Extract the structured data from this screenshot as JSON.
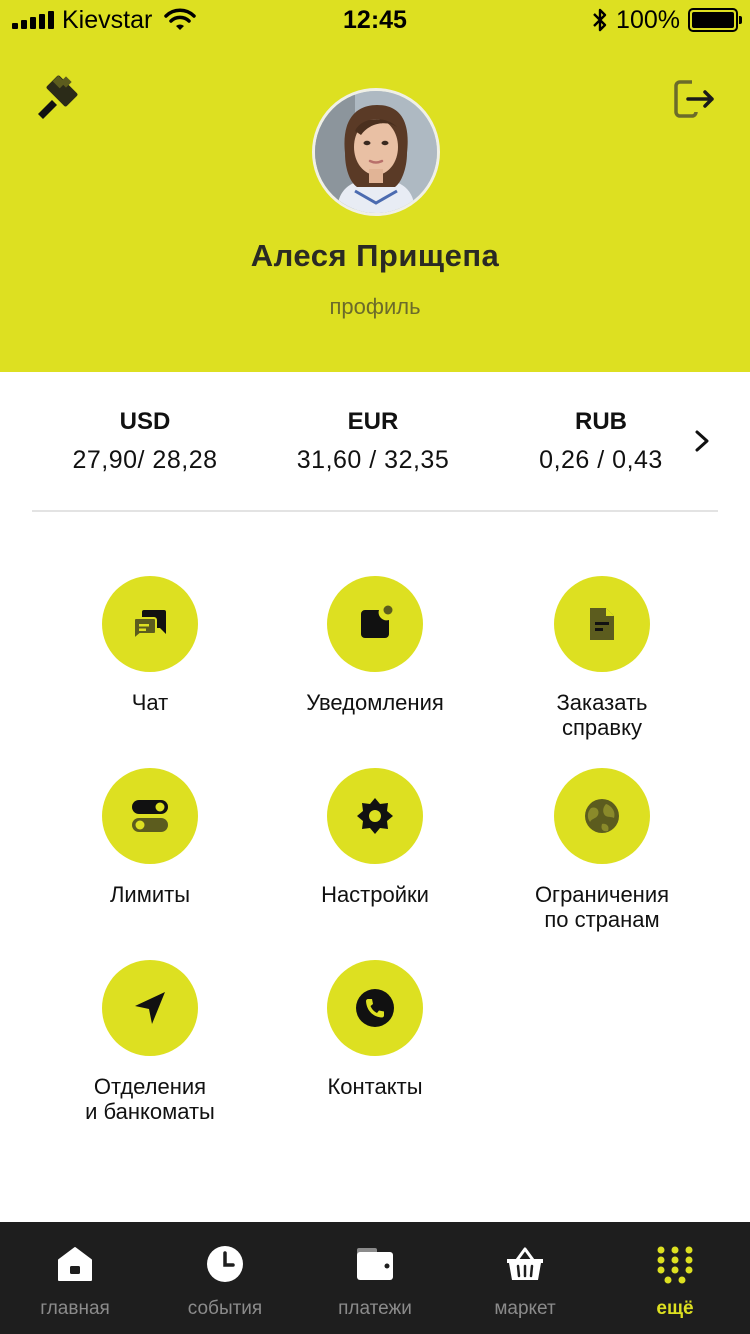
{
  "status_bar": {
    "carrier": "Kievstar",
    "time": "12:45",
    "battery": "100%"
  },
  "profile": {
    "name": "Алеся Прищепа",
    "link": "профиль"
  },
  "rates": [
    {
      "code": "USD",
      "value": "27,90/ 28,28"
    },
    {
      "code": "EUR",
      "value": "31,60 / 32,35"
    },
    {
      "code": "RUB",
      "value": "0,26 / 0,43"
    }
  ],
  "menu": [
    {
      "label": "Чат",
      "icon": "chat-icon"
    },
    {
      "label": "Уведомления",
      "icon": "notifications-icon"
    },
    {
      "label": "Заказать\nсправку",
      "icon": "document-icon"
    },
    {
      "label": "Лимиты",
      "icon": "limits-toggle-icon"
    },
    {
      "label": "Настройки",
      "icon": "gear-icon"
    },
    {
      "label": "Ограничения\nпо странам",
      "icon": "globe-icon"
    },
    {
      "label": "Отделения\nи банкоматы",
      "icon": "location-arrow-icon"
    },
    {
      "label": "Контакты",
      "icon": "phone-icon"
    }
  ],
  "tabbar": [
    {
      "label": "главная",
      "icon": "home-icon",
      "active": false
    },
    {
      "label": "события",
      "icon": "clock-icon",
      "active": false
    },
    {
      "label": "платежи",
      "icon": "wallet-icon",
      "active": false
    },
    {
      "label": "маркет",
      "icon": "basket-icon",
      "active": false
    },
    {
      "label": "ещё",
      "icon": "more-dots-icon",
      "active": true
    }
  ],
  "colors": {
    "accent": "#dde021",
    "tabbar_bg": "#1e1e1e",
    "tab_inactive": "#8b8b8b"
  }
}
